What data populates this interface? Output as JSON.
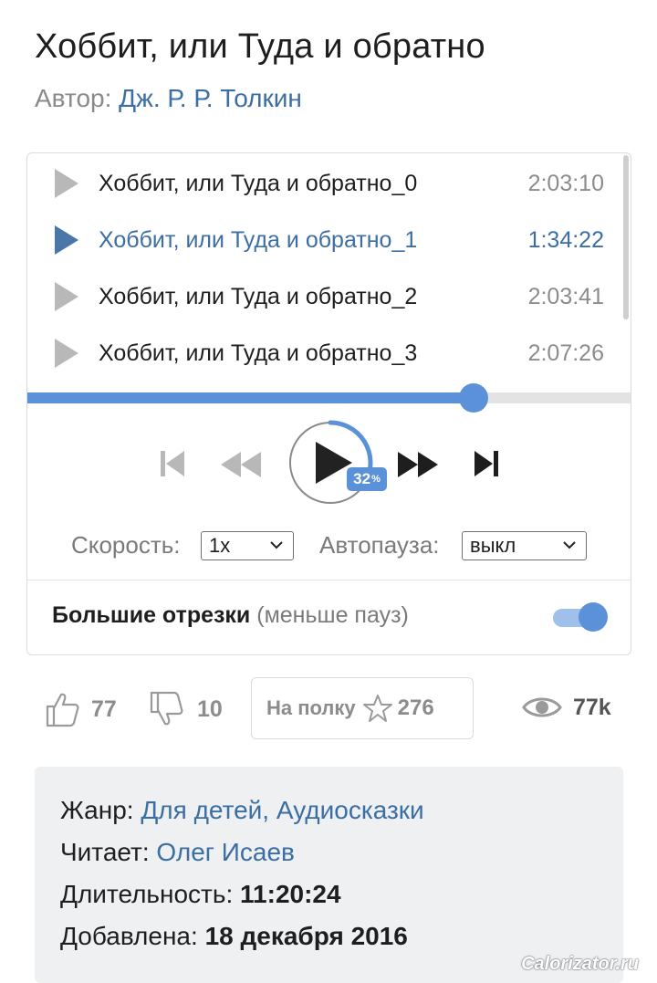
{
  "book": {
    "title": "Хоббит, или Туда и обратно",
    "author_prefix": "Автор:",
    "author_name": "Дж. Р. Р. Толкин"
  },
  "playlist": {
    "tracks": [
      {
        "name": "Хоббит, или Туда и обратно_0",
        "duration": "2:03:10",
        "active": false
      },
      {
        "name": "Хоббит, или Туда и обратно_1",
        "duration": "1:34:22",
        "active": true
      },
      {
        "name": "Хоббит, или Туда и обратно_2",
        "duration": "2:03:41",
        "active": false
      },
      {
        "name": "Хоббит, или Туда и обратно_3",
        "duration": "2:07:26",
        "active": false
      }
    ]
  },
  "player": {
    "seek_fraction": 0.74,
    "progress_percent_value": "32",
    "progress_percent_sign": "%",
    "progress_fraction": 0.32
  },
  "options": {
    "speed_label": "Скорость:",
    "speed_value": "1x",
    "autopause_label": "Автопауза:",
    "autopause_value": "выкл"
  },
  "big_segments": {
    "label": "Большие отрезки",
    "note": "(меньше пауз)",
    "enabled": true
  },
  "stats": {
    "likes": "77",
    "dislikes": "10",
    "shelf_label": "На полку",
    "shelf_count": "276",
    "views": "77k"
  },
  "info": {
    "genre_label": "Жанр:",
    "genre_value": "Для детей, Аудиосказки",
    "reader_label": "Читает:",
    "reader_value": "Олег Исаев",
    "duration_label": "Длительность:",
    "duration_value": "11:20:24",
    "added_label": "Добавлена:",
    "added_value": "18 декабря 2016"
  },
  "watermark": "Calorizator.ru",
  "colors": {
    "accent": "#5b91d8",
    "link": "#3b6ea5",
    "muted": "#8c8c8c"
  }
}
